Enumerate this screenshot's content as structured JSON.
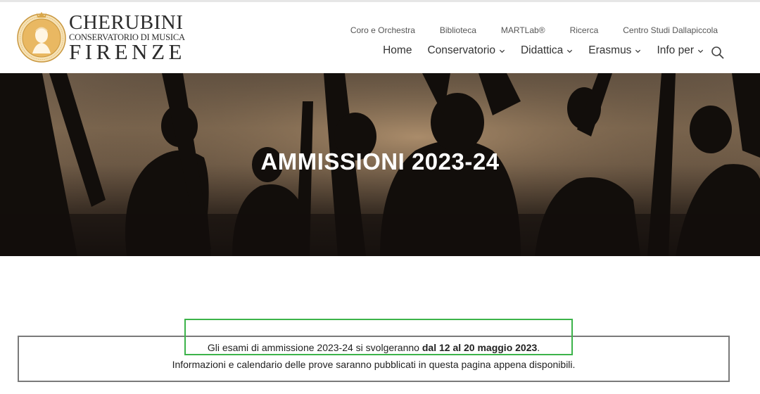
{
  "logo": {
    "line1": "CHERUBINI",
    "line2": "CONSERVATORIO DI MUSICA",
    "line3": "FIRENZE",
    "seal_icon": "conservatory-seal-icon",
    "colors": {
      "gold": "#d9a74b",
      "text": "#2b2b2b"
    }
  },
  "top_menu": {
    "items": [
      "Coro e Orchestra",
      "Biblioteca",
      "MARTLab®",
      "Ricerca",
      "Centro Studi Dallapiccola"
    ]
  },
  "main_menu": {
    "home": "Home",
    "conservatorio": "Conservatorio",
    "didattica": "Didattica",
    "erasmus": "Erasmus",
    "info": "Info per",
    "dropdown_icon": "chevron-down-icon",
    "search_icon": "search-icon"
  },
  "hero": {
    "title": "AMMISSIONI 2023-24"
  },
  "notice": {
    "line1_prefix": "Gli esami di ammissione 2023-24 si svolgeranno ",
    "line1_bold": "dal 12 al 20 maggio 2023",
    "line1_suffix": ".",
    "line2": "Informazioni e calendario delle prove saranno pubblicati in questa pagina appena disponibili.",
    "highlight_color": "#3cb34a",
    "border_color": "#7a7a7a"
  }
}
